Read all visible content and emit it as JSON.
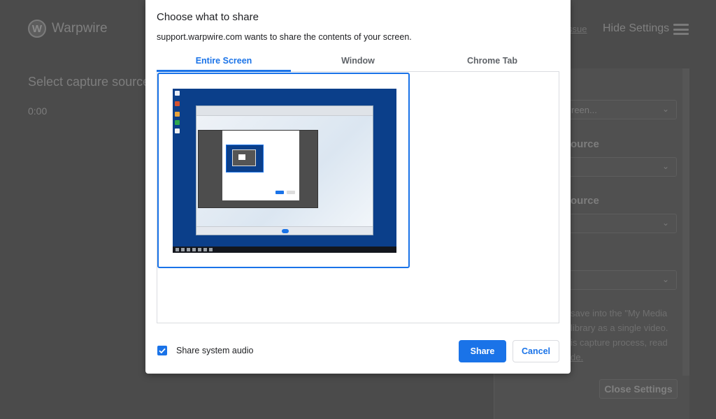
{
  "background_app": {
    "logo_letter": "W",
    "brand_name": "Warpwire",
    "report_link": "ssue",
    "hide_settings": "Hide Settings",
    "capture_title": "Select capture source",
    "timer": "0:00",
    "settings_panel": {
      "field1_value": "reen...",
      "label2": "ource",
      "label3": "ource",
      "description_lines": [
        "save into the \"My Media",
        "library as a single video.",
        "is capture process, read",
        "de."
      ],
      "close_settings": "Close Settings"
    }
  },
  "dialog": {
    "title": "Choose what to share",
    "subtitle": "support.warpwire.com wants to share the contents of your screen.",
    "tabs": [
      {
        "label": "Entire Screen",
        "active": true
      },
      {
        "label": "Window",
        "active": false
      },
      {
        "label": "Chrome Tab",
        "active": false
      }
    ],
    "preview_icon": "screen-thumbnail",
    "share_audio": {
      "label": "Share system audio",
      "checked": true
    },
    "share_button": "Share",
    "cancel_button": "Cancel"
  },
  "colors": {
    "accent": "#1a73e8",
    "overlay": "#4b4b4b",
    "desktop": "#0b3f8a"
  }
}
